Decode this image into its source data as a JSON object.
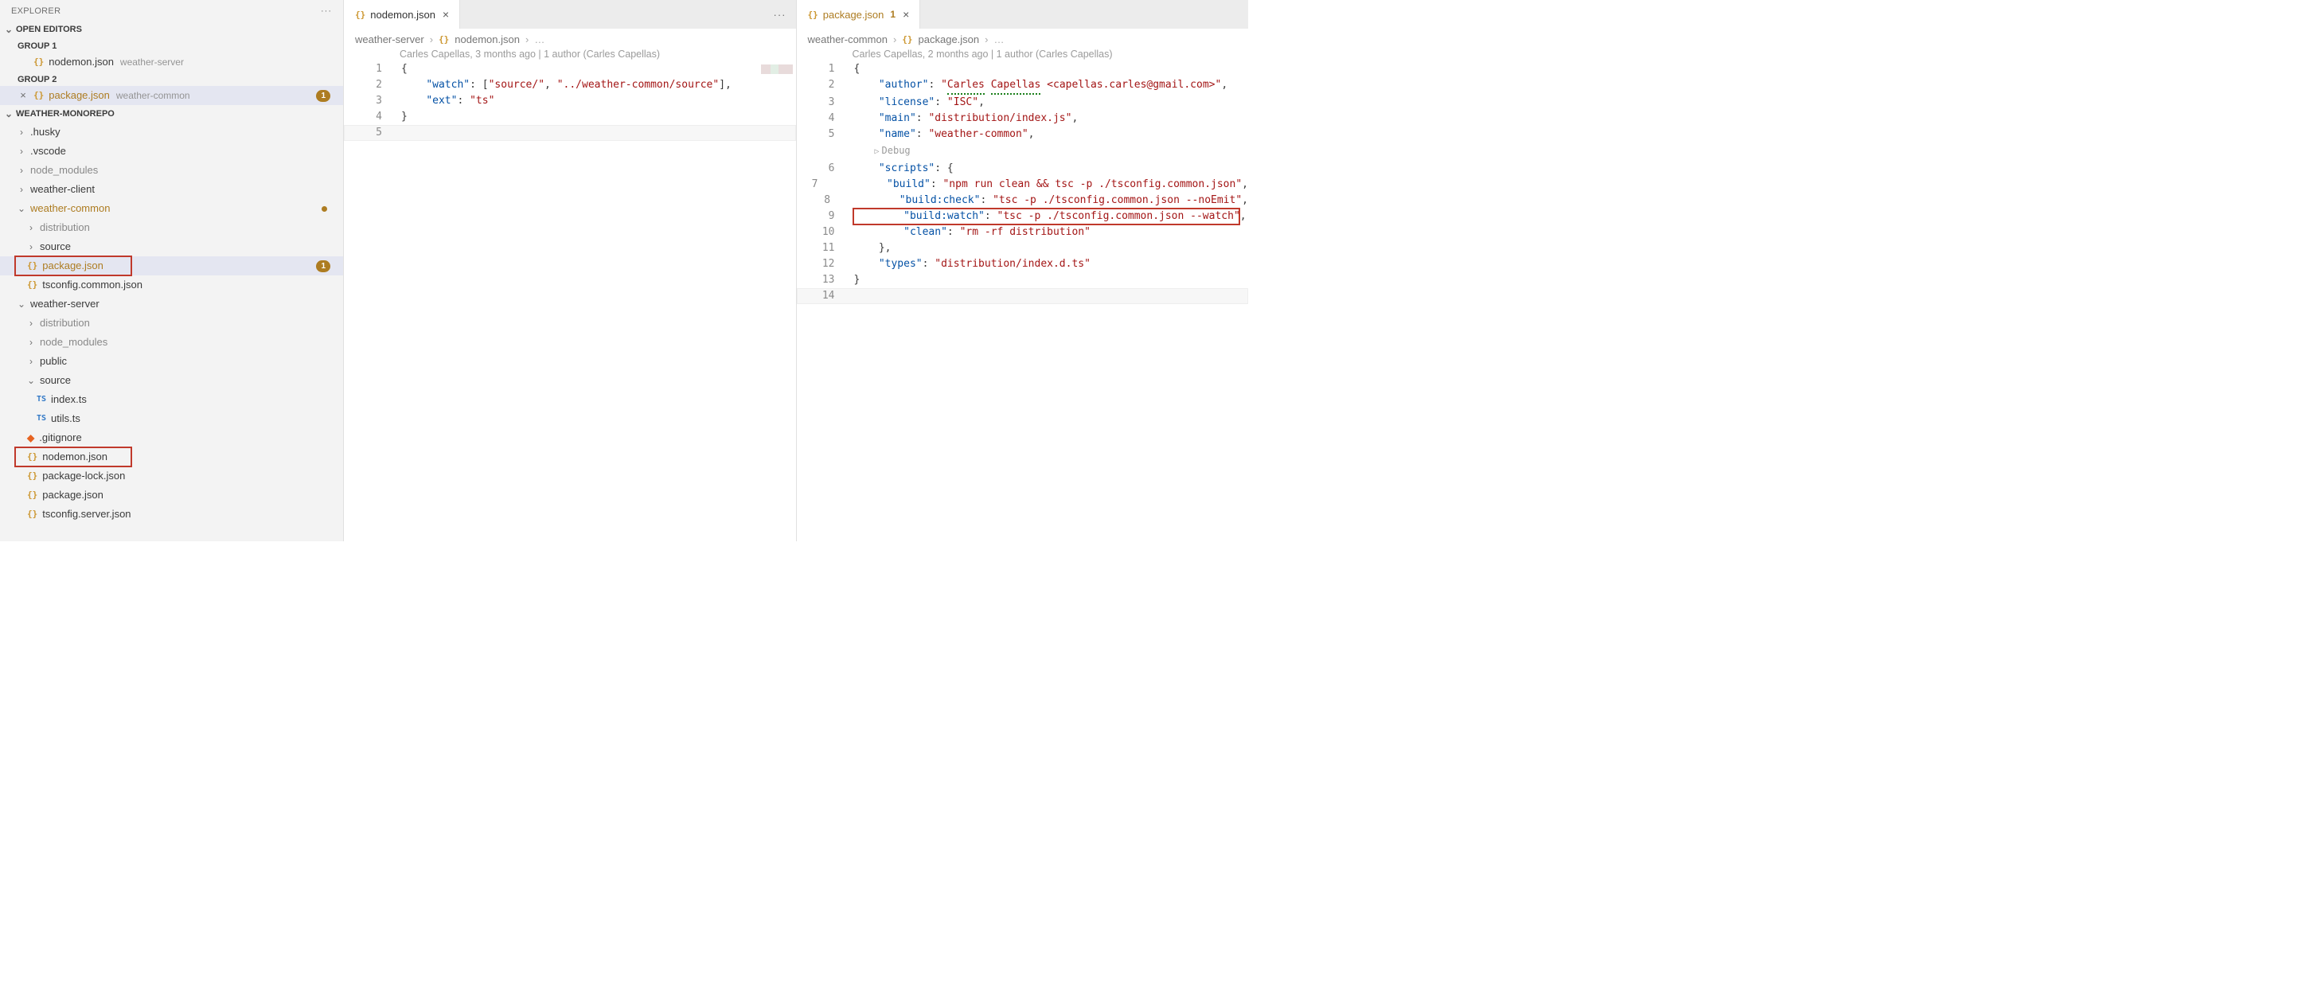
{
  "sidebar": {
    "title": "EXPLORER",
    "openEditors": "OPEN EDITORS",
    "group1": "GROUP 1",
    "group2": "GROUP 2",
    "openItems": [
      {
        "name": "nodemon.json",
        "folder": "weather-server",
        "modified": false
      },
      {
        "name": "package.json",
        "folder": "weather-common",
        "modified": true,
        "badge": "1",
        "hasClose": true
      }
    ],
    "workspace": "WEATHER-MONOREPO",
    "tree": {
      "husky": ".husky",
      "vscode": ".vscode",
      "node_modules": "node_modules",
      "weather_client": "weather-client",
      "weather_common": "weather-common",
      "wc_distribution": "distribution",
      "wc_source": "source",
      "wc_package": "package.json",
      "wc_badge": "1",
      "wc_tsconfig": "tsconfig.common.json",
      "weather_server": "weather-server",
      "ws_distribution": "distribution",
      "ws_node_modules": "node_modules",
      "ws_public": "public",
      "ws_source": "source",
      "ws_index": "index.ts",
      "ws_utils": "utils.ts",
      "ws_gitignore": ".gitignore",
      "ws_nodemon": "nodemon.json",
      "ws_packagelock": "package-lock.json",
      "ws_package": "package.json",
      "ws_tsconfig": "tsconfig.server.json"
    }
  },
  "left": {
    "tabName": "nodemon.json",
    "breadcrumb": {
      "root": "weather-server",
      "file": "nodemon.json"
    },
    "codelens": "Carles Capellas, 3 months ago | 1 author (Carles Capellas)",
    "code": {
      "l1": "{",
      "l2a": "\"watch\"",
      "l2b": ": [",
      "l2c": "\"source/\"",
      "l2d": ", ",
      "l2e": "\"../weather-common/source\"",
      "l2f": "],",
      "l3a": "\"ext\"",
      "l3b": ": ",
      "l3c": "\"ts\"",
      "l4": "}",
      "n1": "1",
      "n2": "2",
      "n3": "3",
      "n4": "4",
      "n5": "5"
    }
  },
  "right": {
    "tabName": "package.json",
    "tabBadge": "1",
    "breadcrumb": {
      "root": "weather-common",
      "file": "package.json"
    },
    "codelens": "Carles Capellas, 2 months ago | 1 author (Carles Capellas)",
    "debug": "Debug",
    "code": {
      "l1": "{",
      "l2a": "\"author\"",
      "l2b": ": ",
      "l2c1": "\"",
      "l2c2": "Carles",
      "l2c3": " ",
      "l2c4": "Capellas",
      "l2c5": " <capellas.carles@gmail.com>\"",
      "l2d": ",",
      "l3a": "\"license\"",
      "l3b": ": ",
      "l3c": "\"ISC\"",
      "l3d": ",",
      "l4a": "\"main\"",
      "l4b": ": ",
      "l4c": "\"distribution/index.js\"",
      "l4d": ",",
      "l5a": "\"name\"",
      "l5b": ": ",
      "l5c": "\"weather-common\"",
      "l5d": ",",
      "l6a": "\"scripts\"",
      "l6b": ": {",
      "l7a": "\"build\"",
      "l7b": ": ",
      "l7c": "\"npm run clean && tsc -p ./tsconfig.common.json\"",
      "l7d": ",",
      "l8a": "\"build:check\"",
      "l8b": ": ",
      "l8c": "\"tsc -p ./tsconfig.common.json --noEmit\"",
      "l8d": ",",
      "l9a": "\"build:watch\"",
      "l9b": ": ",
      "l9c": "\"tsc -p ./tsconfig.common.json --watch\"",
      "l9d": ",",
      "l10a": "\"clean\"",
      "l10b": ": ",
      "l10c": "\"rm -rf distribution\"",
      "l11": "},",
      "l12a": "\"types\"",
      "l12b": ": ",
      "l12c": "\"distribution/index.d.ts\"",
      "l13": "}",
      "n1": "1",
      "n2": "2",
      "n3": "3",
      "n4": "4",
      "n5": "5",
      "n6": "6",
      "n7": "7",
      "n8": "8",
      "n9": "9",
      "n10": "10",
      "n11": "11",
      "n12": "12",
      "n13": "13",
      "n14": "14"
    }
  }
}
